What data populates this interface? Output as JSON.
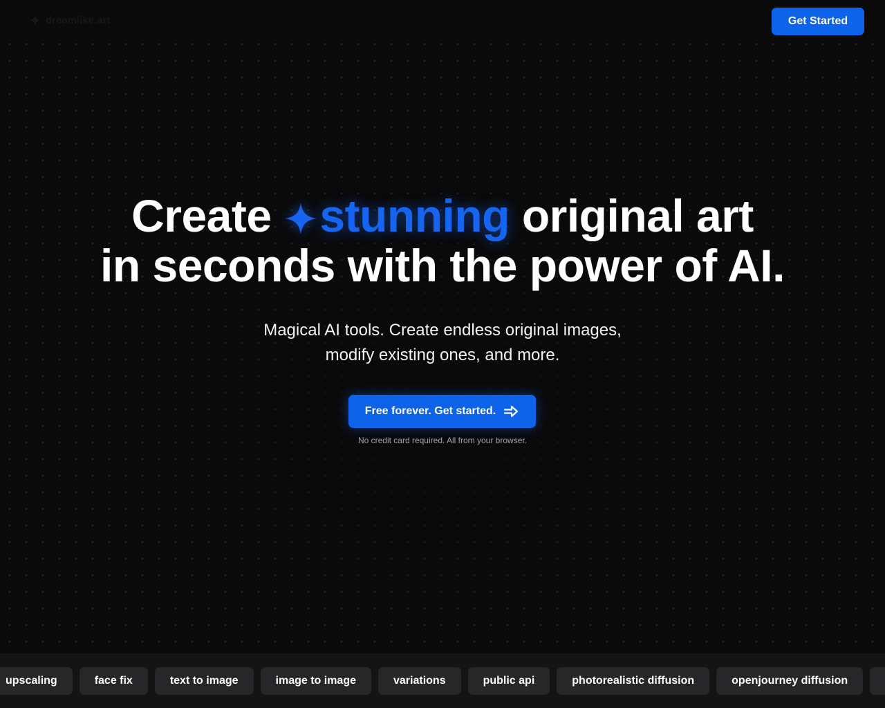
{
  "header": {
    "logo_text": "dreamlike.art",
    "logo_icon": "sparkle-icon",
    "cta_label": "Get Started"
  },
  "hero": {
    "title_word_1": "Create",
    "title_accent": "stunning",
    "title_rest_line_1": "original art",
    "title_line_2": "in seconds with the power of AI.",
    "subtitle_line_1": "Magical AI tools. Create endless original images,",
    "subtitle_line_2": "modify existing ones, and more.",
    "cta_label": "Free forever. Get started.",
    "cta_icon": "arrow-right-icon",
    "note": "No credit card required. All from your browser."
  },
  "tags": [
    "upscaling",
    "face fix",
    "text to image",
    "image to image",
    "variations",
    "public api",
    "photorealistic diffusion",
    "openjourney diffusion",
    ""
  ],
  "colors": {
    "background": "#0a0a0b",
    "accent": "#1565f0",
    "button": "#0d63ea",
    "tag_background": "#27272a",
    "strip_background": "#141415"
  }
}
